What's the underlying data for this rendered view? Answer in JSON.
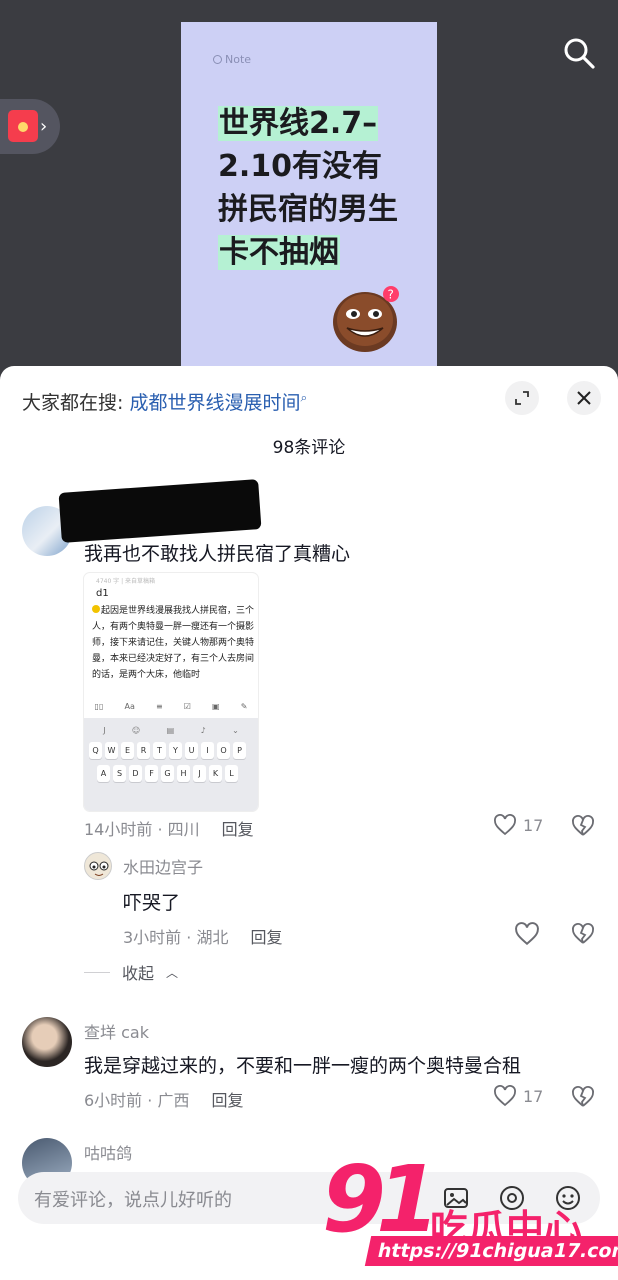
{
  "note": {
    "tag": "Note",
    "line1": "世界线2.7–",
    "line2": "2.10有没有",
    "line3": "拼民宿的男生",
    "line4": "卡不抽烟"
  },
  "search_bar": {
    "prefix": "大家都在搜:",
    "keyword": "成都世界线漫展时间"
  },
  "comments_header": {
    "count_label": "98条评论"
  },
  "comments": [
    {
      "text": "我再也不敢找人拼民宿了真糟心",
      "meta": "14小时前 · 四川",
      "reply_label": "回复",
      "likes": "17",
      "attachment": {
        "head": "4740 字 | 来自草稿箱",
        "title": "d1",
        "body": "起因是世界线漫展我找人拼民宿，三个人，有两个奥特曼一胖一瘦还有一个摄影师，接下来请记住，关键人物那两个奥特曼，本来已经决定好了，有三个人去房间的话，是两个大床，他临时",
        "toolbar_text": "Aa",
        "keys_row1": [
          "Q",
          "W",
          "E",
          "R",
          "T",
          "Y",
          "U",
          "I",
          "O",
          "P"
        ],
        "keys_row2": [
          "A",
          "S",
          "D",
          "F",
          "G",
          "H",
          "J",
          "K",
          "L"
        ]
      },
      "reply": {
        "name": "水田边宫子",
        "text": "吓哭了",
        "meta": "3小时前 · 湖北",
        "reply_label": "回复"
      },
      "collapse_label": "收起"
    },
    {
      "name": "查垟 cak",
      "text": "我是穿越过来的，不要和一胖一瘦的两个奥特曼合租",
      "meta": "6小时前 · 广西",
      "reply_label": "回复",
      "likes": "17"
    },
    {
      "name": "咕咕鸽"
    }
  ],
  "input": {
    "placeholder": "有爱评论，说点儿好听的"
  },
  "watermark": {
    "number": "91",
    "brand": "吃瓜中心",
    "url": "https://91chigua17.com"
  },
  "colors": {
    "accent_link": "#2a5fb0",
    "watermark": "#f4226b"
  }
}
